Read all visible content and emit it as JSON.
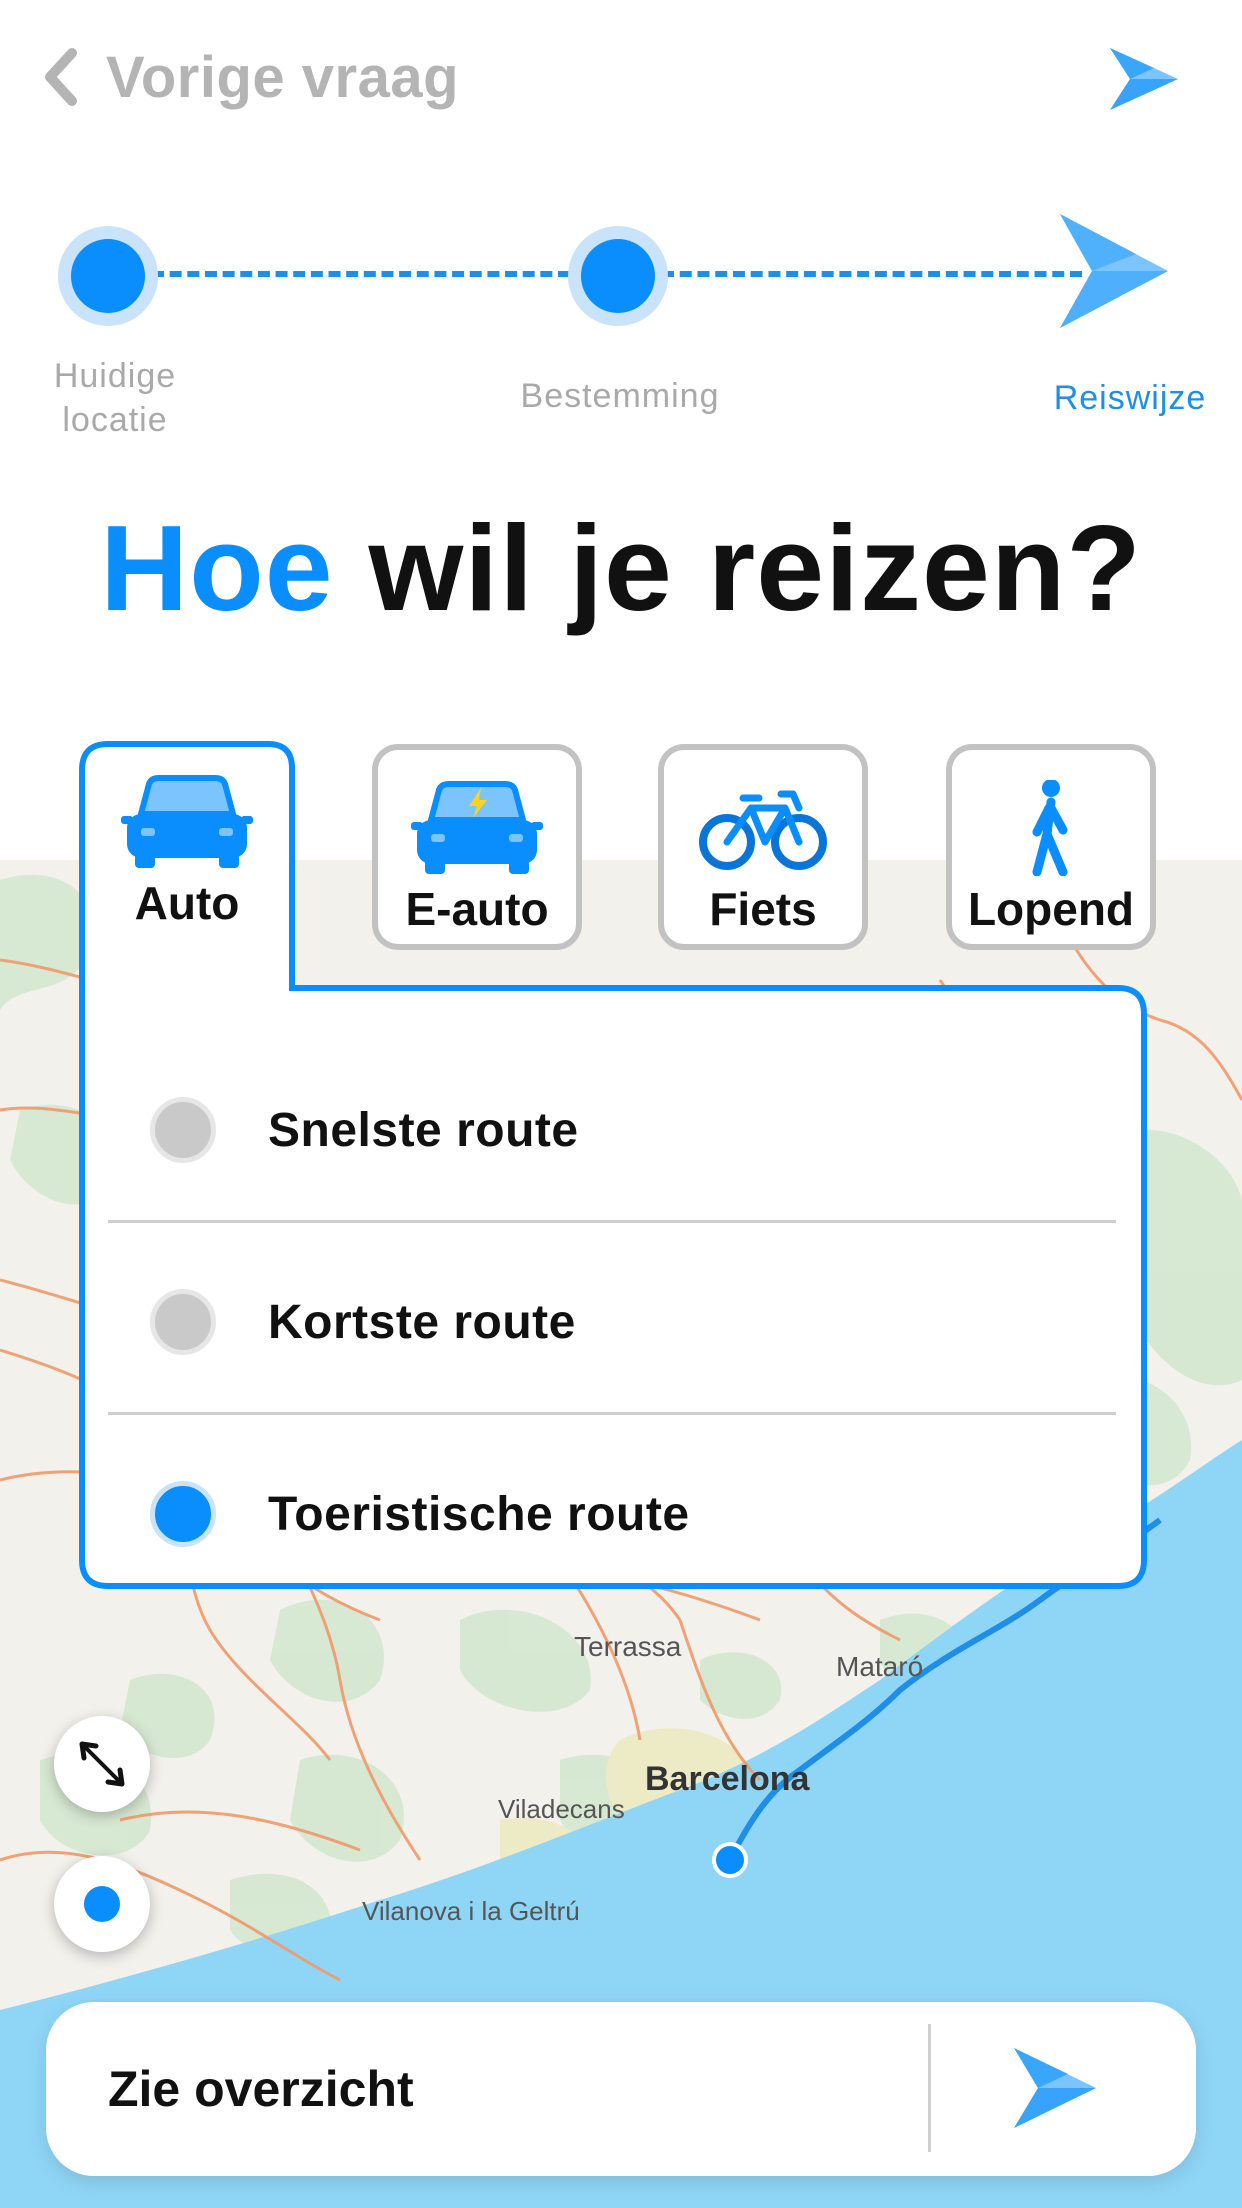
{
  "header": {
    "back_label": "Vorige vraag"
  },
  "stepper": {
    "steps": [
      {
        "label_line1": "Huidige",
        "label_line2": "locatie",
        "state": "done"
      },
      {
        "label": "Bestemming",
        "state": "done"
      },
      {
        "label": "Reiswijze",
        "state": "current"
      }
    ]
  },
  "heading": {
    "accent": "Hoe",
    "rest": "wil je reizen?"
  },
  "transport": {
    "selected": "Auto",
    "options": [
      {
        "label": "Auto",
        "icon": "car-icon"
      },
      {
        "label": "E-auto",
        "icon": "electric-car-icon"
      },
      {
        "label": "Fiets",
        "icon": "bicycle-icon"
      },
      {
        "label": "Lopend",
        "icon": "walking-person-icon"
      }
    ]
  },
  "routes": {
    "selected": "Toeristische route",
    "options": [
      {
        "label": "Snelste route",
        "checked": false
      },
      {
        "label": "Kortste route",
        "checked": false
      },
      {
        "label": "Toeristische route",
        "checked": true
      }
    ]
  },
  "map": {
    "places": [
      "Terrassa",
      "Mataró",
      "Barcelona",
      "Viladecans",
      "Vilanova i la Geltrú"
    ]
  },
  "bottom": {
    "label": "Zie overzicht"
  },
  "colors": {
    "accent": "#0a8dfd",
    "muted": "#b4b4b4",
    "sea": "#8fd6f6",
    "road": "#ef9a6a"
  }
}
